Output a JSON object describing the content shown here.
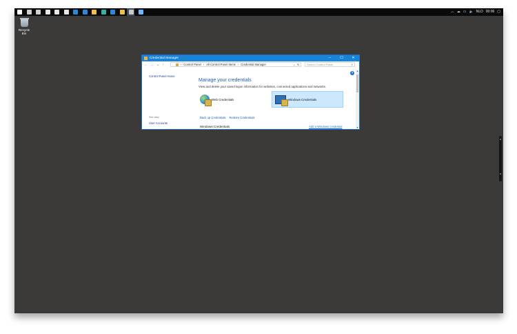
{
  "desktop": {
    "icon_label": "Recycle Bin"
  },
  "taskbar": {
    "icon_colors": [
      "#ffffff",
      "#cfcfcf",
      "#cfcfcf",
      "#e6e6e6",
      "#e6e6e6",
      "#e6e6e6",
      "#2b88d8",
      "#2b88d8",
      "#f0c040",
      "#2fb4a6",
      "#2b88d8",
      "#f0c040",
      "#c9c9c9",
      "#6fb8ff"
    ],
    "tray": {
      "language": "NLD",
      "time": "00:06"
    }
  },
  "window": {
    "title": "Credential Manager",
    "buttons": {
      "minimize": "–",
      "maximize": "☐",
      "close": "✕"
    },
    "breadcrumb": [
      "Control Panel",
      "All Control Panel Items",
      "Credential Manager"
    ],
    "search_placeholder": "Search Control Panel",
    "left_pane": {
      "home": "Control Panel Home",
      "see_also": "See also",
      "user_accounts": "User Accounts"
    },
    "main": {
      "heading": "Manage your credentials",
      "subtitle": "View and delete your saved logon information for websites, connected applications and networks.",
      "web_credentials": "Web Credentials",
      "windows_credentials": "Windows Credentials",
      "backup_link": "Back up Credentials",
      "restore_link": "Restore Credentials",
      "section_label": "Windows Credentials",
      "add_link": "Add a Windows credential"
    },
    "help": "?"
  }
}
